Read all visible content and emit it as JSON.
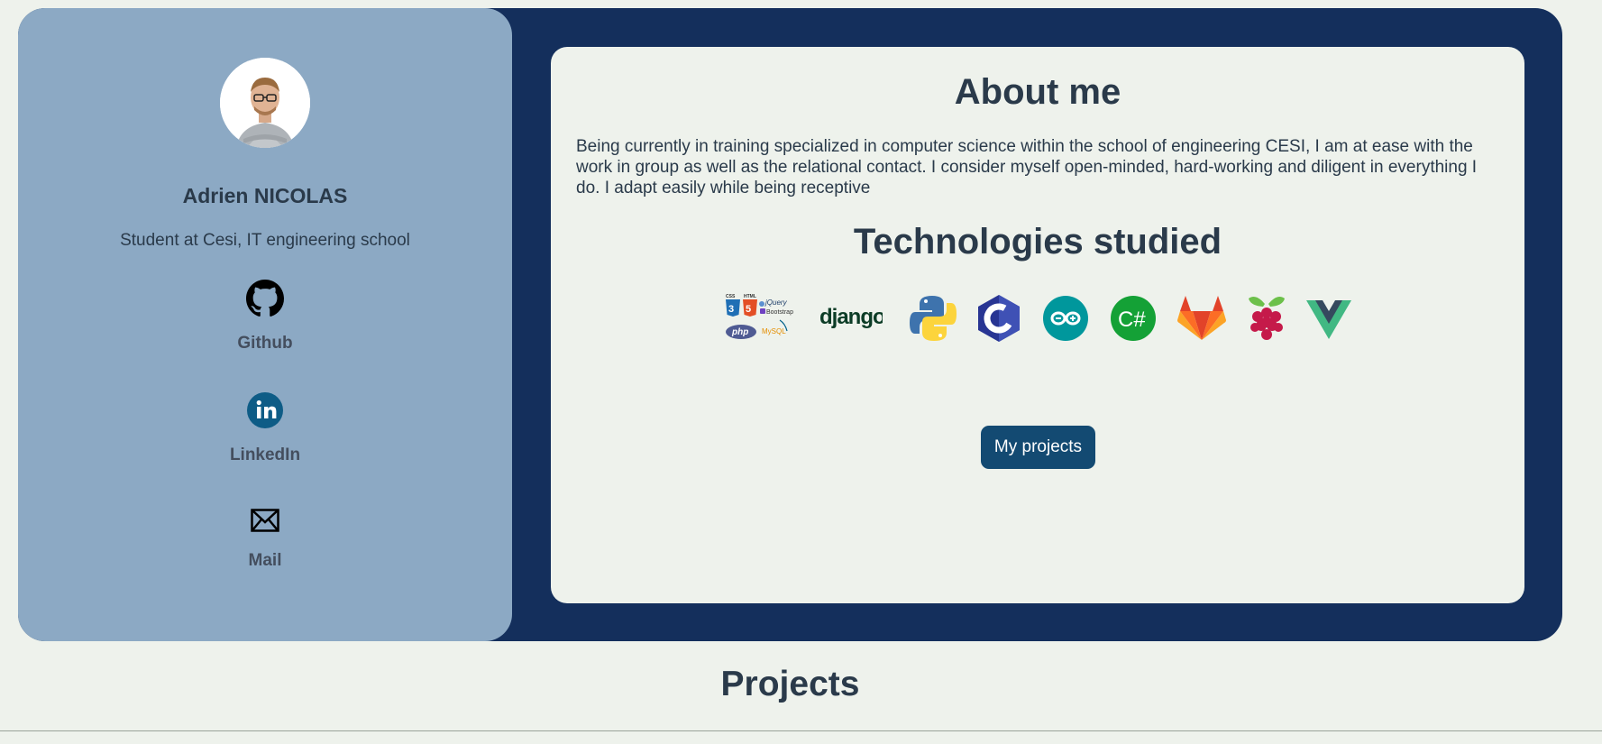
{
  "profile": {
    "name": "Adrien NICOLAS",
    "role": "Student at Cesi, IT engineering school"
  },
  "social": {
    "github": "Github",
    "linkedin": "LinkedIn",
    "mail": "Mail"
  },
  "about": {
    "title": "About me",
    "text": "Being currently in training specialized in computer science within the school of engineering CESI, I am at ease with the work in group as well as the relational contact. I consider myself open-minded, hard-working and diligent in everything I do. I adapt easily while being receptive"
  },
  "technologies": {
    "title": "Technologies studied",
    "items": [
      {
        "icon": "web-stack-icon",
        "labels": [
          "CSS",
          "HTML",
          "jQuery",
          "Bootstrap",
          "php",
          "MySQL"
        ]
      },
      {
        "icon": "django-icon",
        "label": "django"
      },
      {
        "icon": "python-icon"
      },
      {
        "icon": "c-language-icon",
        "label": "C"
      },
      {
        "icon": "arduino-icon"
      },
      {
        "icon": "csharp-icon",
        "label": "C#"
      },
      {
        "icon": "gitlab-icon"
      },
      {
        "icon": "raspberry-pi-icon"
      },
      {
        "icon": "vue-icon"
      }
    ]
  },
  "projects_button": "My projects",
  "projects_title": "Projects",
  "colors": {
    "page_bg": "#eef2ec",
    "card_bg": "#142f5c",
    "sidebar_bg": "#8ca9c4",
    "button_bg": "#134a72",
    "text": "#2a3a4a"
  }
}
